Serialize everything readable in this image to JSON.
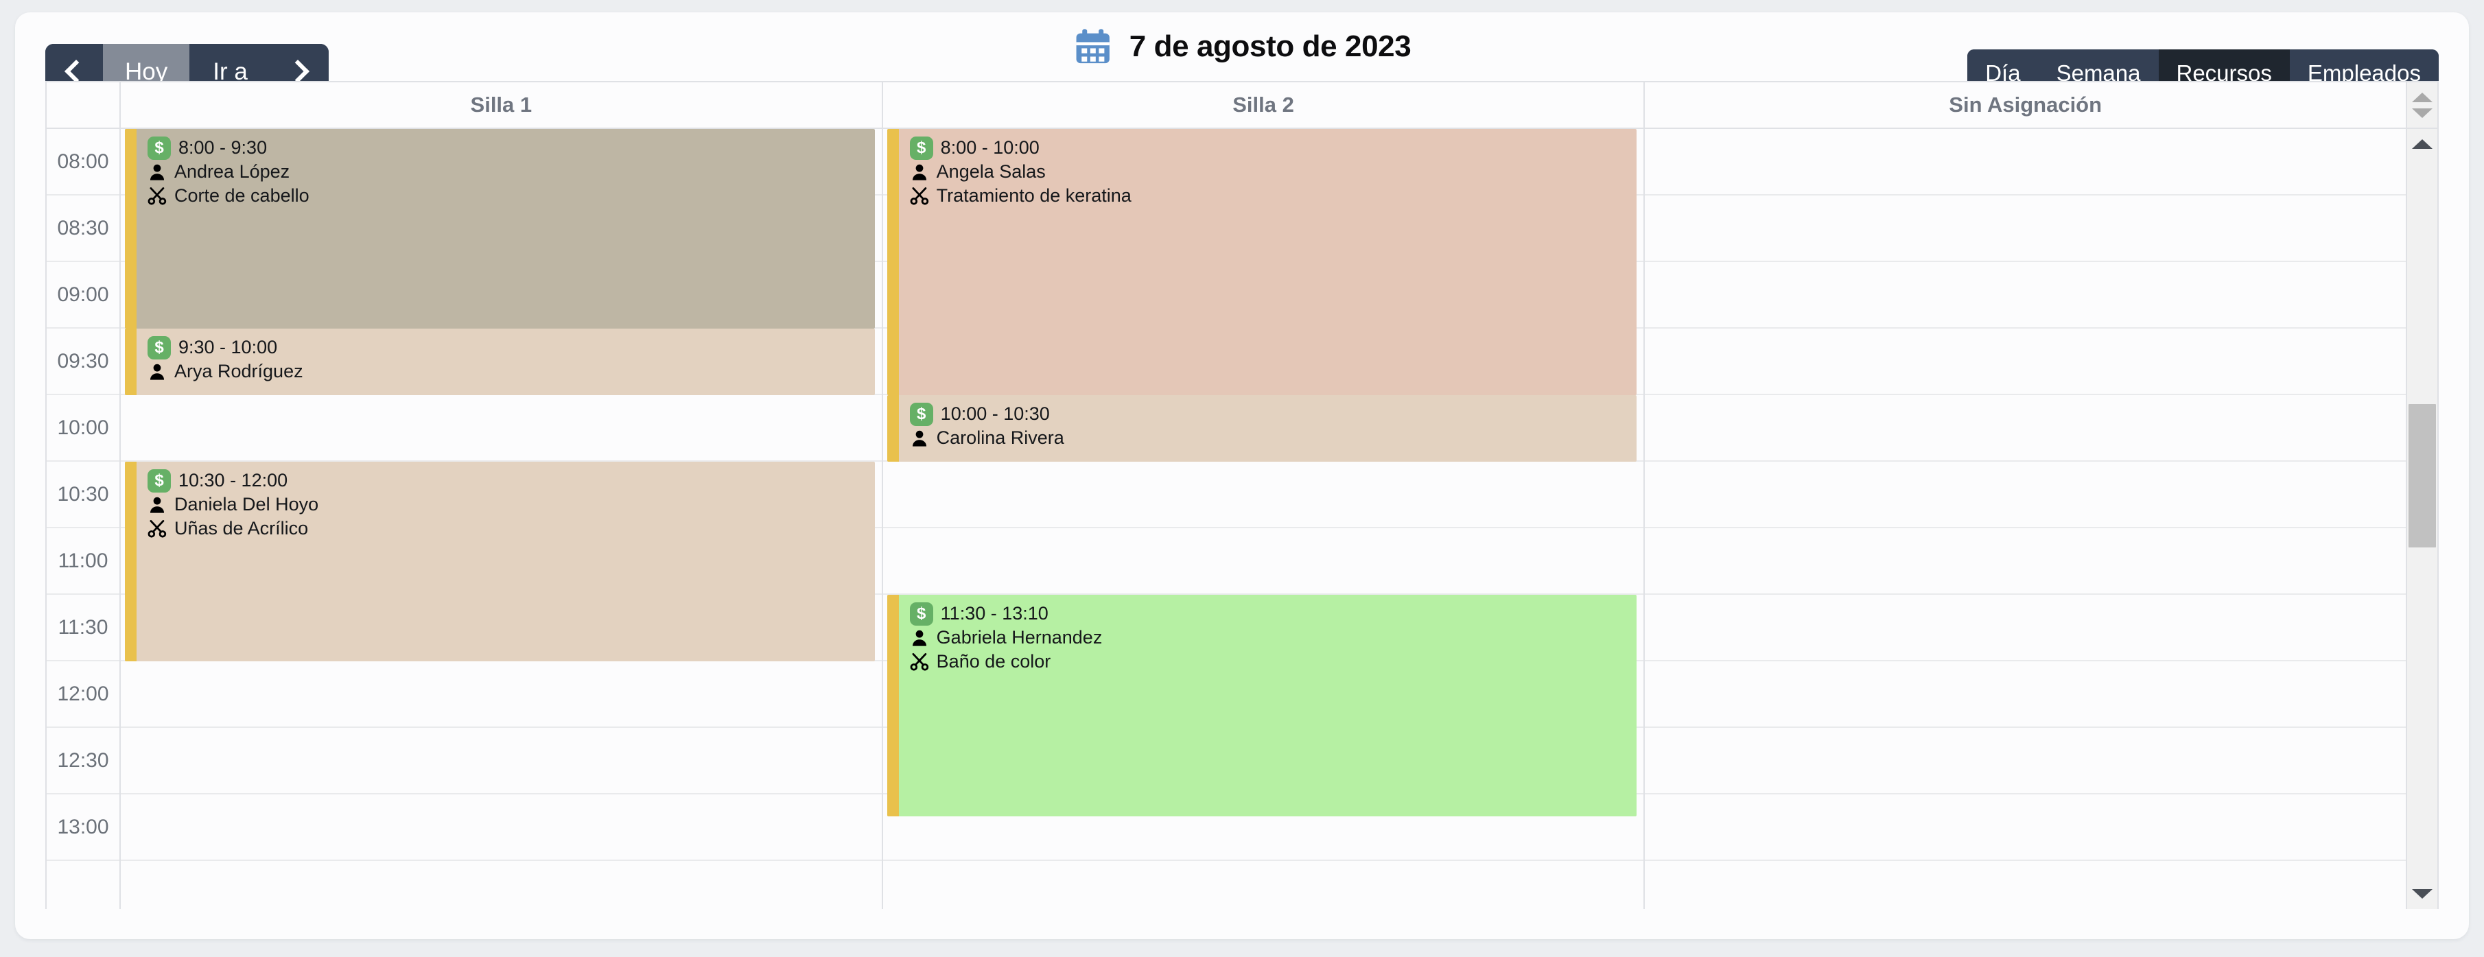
{
  "toolbar": {
    "prev_label": "",
    "today_label": "Hoy",
    "goto_label": "Ir a",
    "next_label": "",
    "prev_icon": "chevron-left-icon",
    "next_icon": "chevron-right-icon"
  },
  "header": {
    "title": "7 de agosto de 2023",
    "calendar_icon": "calendar-icon",
    "accent_color": "#5b8fc9"
  },
  "views": {
    "options": [
      "Día",
      "Semana",
      "Recursos",
      "Empleados"
    ],
    "active": "Recursos"
  },
  "calendar": {
    "columns": [
      "Silla 1",
      "Silla 2",
      "Sin Asignación"
    ],
    "time_labels": [
      "08:00",
      "08:30",
      "09:00",
      "09:30",
      "10:00",
      "10:30",
      "11:00",
      "11:30",
      "12:00",
      "12:30",
      "13:00"
    ],
    "slot_minutes": 30,
    "start_time": "08:00",
    "end_time": "13:30",
    "accent_bar_color": "#e9c14c",
    "money_badge_color": "#66b066",
    "icons": {
      "money": "money-badge-icon",
      "client": "person-icon",
      "service": "scissors-icon"
    },
    "events": [
      {
        "column": "Silla 1",
        "time": "8:00 - 9:30",
        "client": "Andrea López",
        "service": "Corte de cabello",
        "color": "#beb6a4",
        "start_min": 0,
        "duration_min": 90
      },
      {
        "column": "Silla 1",
        "time": "9:30 - 10:00",
        "client": "Arya Rodríguez",
        "service": "",
        "color": "#e3d2c0",
        "start_min": 90,
        "duration_min": 30
      },
      {
        "column": "Silla 1",
        "time": "10:30 - 12:00",
        "client": "Daniela Del Hoyo",
        "service": "Uñas de Acrílico",
        "color": "#e3d2c0",
        "start_min": 150,
        "duration_min": 90
      },
      {
        "column": "Silla 2",
        "time": "8:00 - 10:00",
        "client": "Angela Salas",
        "service": "Tratamiento de keratina",
        "color": "#e4c7b7",
        "start_min": 0,
        "duration_min": 120
      },
      {
        "column": "Silla 2",
        "time": "10:00 - 10:30",
        "client": "Carolina Rivera",
        "service": "",
        "color": "#e3d2c0",
        "start_min": 120,
        "duration_min": 30
      },
      {
        "column": "Silla 2",
        "time": "11:30 - 13:10",
        "client": "Gabriela Hernandez",
        "service": "Baño de color",
        "color": "#b6f0a3",
        "start_min": 210,
        "duration_min": 100
      }
    ]
  },
  "scrollbar": {
    "up_icon": "triangle-up-icon",
    "down_icon": "triangle-down-icon",
    "thumb_top_pct": 34,
    "thumb_height_pct": 20
  },
  "header_spinner": {
    "up_icon": "triangle-up-icon",
    "down_icon": "triangle-down-icon"
  }
}
